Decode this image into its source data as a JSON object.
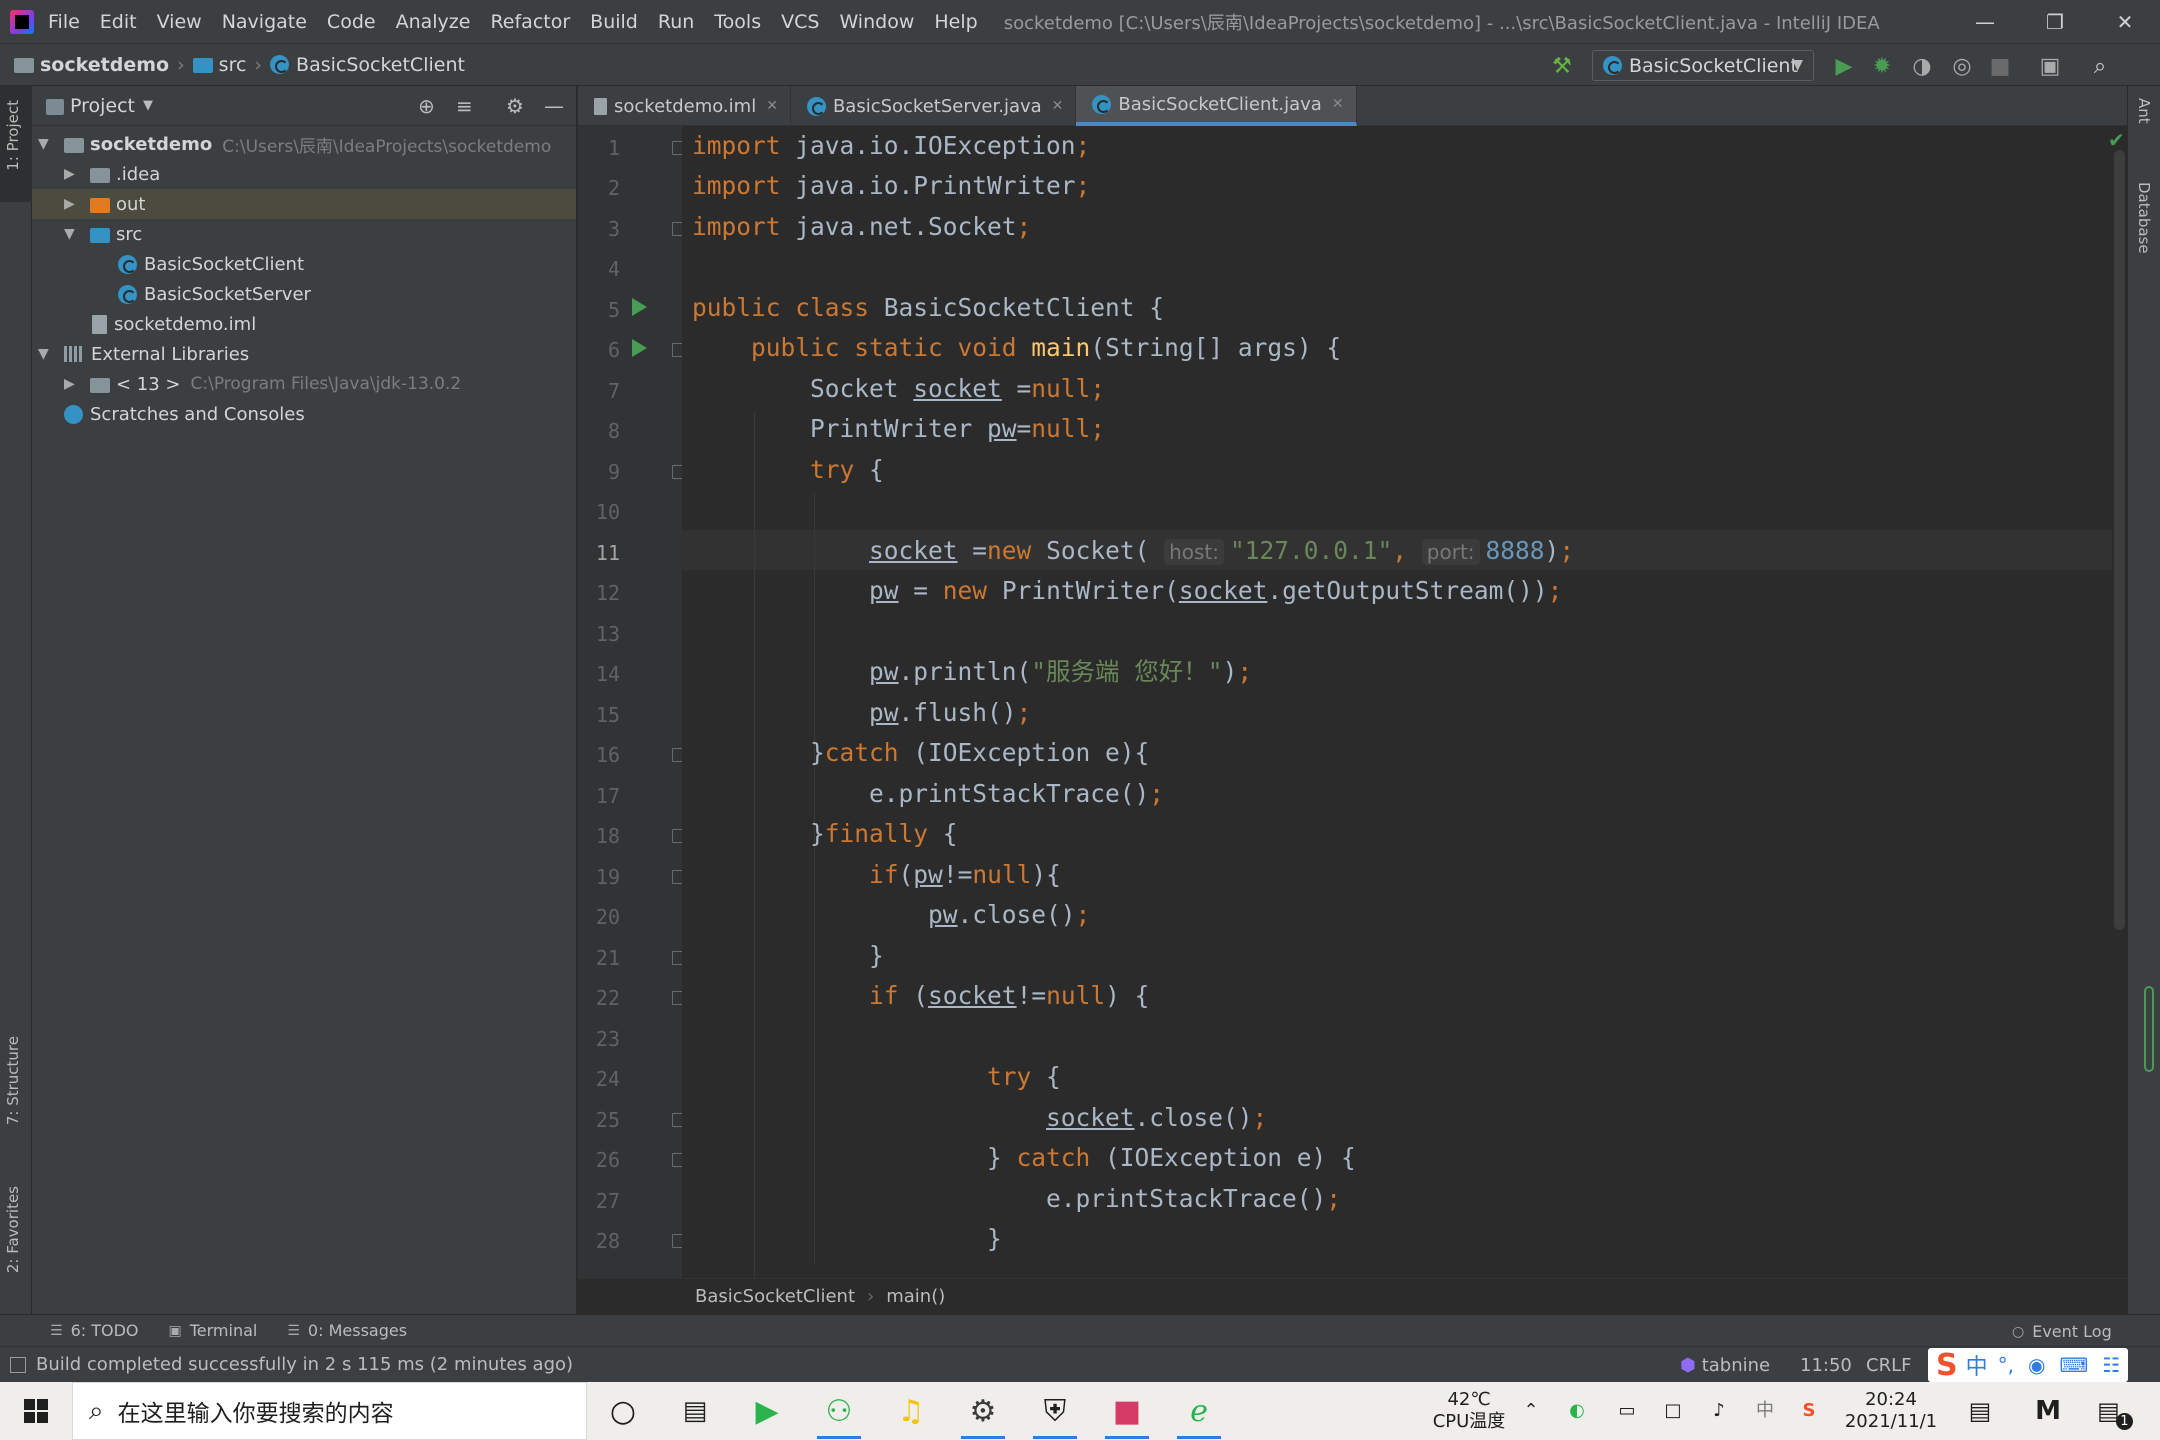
{
  "menubar": {
    "items": [
      "File",
      "Edit",
      "View",
      "Navigate",
      "Code",
      "Analyze",
      "Refactor",
      "Build",
      "Run",
      "Tools",
      "VCS",
      "Window",
      "Help"
    ],
    "title": "socketdemo [C:\\Users\\辰南\\IdeaProjects\\socketdemo] - ...\\src\\BasicSocketClient.java - IntelliJ IDEA"
  },
  "navbar": {
    "crumbs": [
      "socketdemo",
      "src",
      "BasicSocketClient"
    ],
    "run_config": "BasicSocketClient"
  },
  "project_panel": {
    "title": "Project",
    "tree": [
      {
        "label": "socketdemo",
        "path": "C:\\Users\\辰南\\IdeaProjects\\socketdemo"
      },
      {
        "label": ".idea"
      },
      {
        "label": "out"
      },
      {
        "label": "src"
      },
      {
        "label": "BasicSocketClient"
      },
      {
        "label": "BasicSocketServer"
      },
      {
        "label": "socketdemo.iml"
      },
      {
        "label": "External Libraries"
      },
      {
        "label": "< 13 >",
        "path": "C:\\Program Files\\Java\\jdk-13.0.2"
      },
      {
        "label": "Scratches and Consoles"
      }
    ]
  },
  "left_tabs": [
    "1: Project",
    "7: Structure",
    "2: Favorites"
  ],
  "right_tabs": [
    "Ant",
    "Database"
  ],
  "editor": {
    "tabs": [
      "socketdemo.iml",
      "BasicSocketServer.java",
      "BasicSocketClient.java"
    ],
    "active_tab": 2,
    "line_numbers": [
      "1",
      "2",
      "3",
      "4",
      "5",
      "6",
      "7",
      "8",
      "9",
      "10",
      "11",
      "12",
      "13",
      "14",
      "15",
      "16",
      "17",
      "18",
      "19",
      "20",
      "21",
      "22",
      "23",
      "24",
      "25",
      "26",
      "27",
      "28"
    ],
    "current_line": "11",
    "hints": {
      "host": "host:",
      "port": "port:"
    },
    "strings": {
      "ip": "\"127.0.0.1\"",
      "message": "\"服务端 您好！\""
    },
    "numbers": {
      "port": "8888"
    },
    "breadcrumb": [
      "BasicSocketClient",
      "main()"
    ]
  },
  "tool_bar": {
    "items": [
      "6: TODO",
      "Terminal",
      "0: Messages"
    ],
    "event_log": "Event Log"
  },
  "status_bar": {
    "message": "Build completed successfully in 2 s 115 ms (2 minutes ago)",
    "plugin": "tabnine",
    "position": "11:50",
    "line_sep": "CRLF"
  },
  "taskbar": {
    "search_placeholder": "在这里输入你要搜索的内容",
    "temperature": "42℃",
    "temperature_label": "CPU温度",
    "ime": "中",
    "time": "20:24",
    "date": "2021/11/1",
    "notification_count": "1"
  }
}
